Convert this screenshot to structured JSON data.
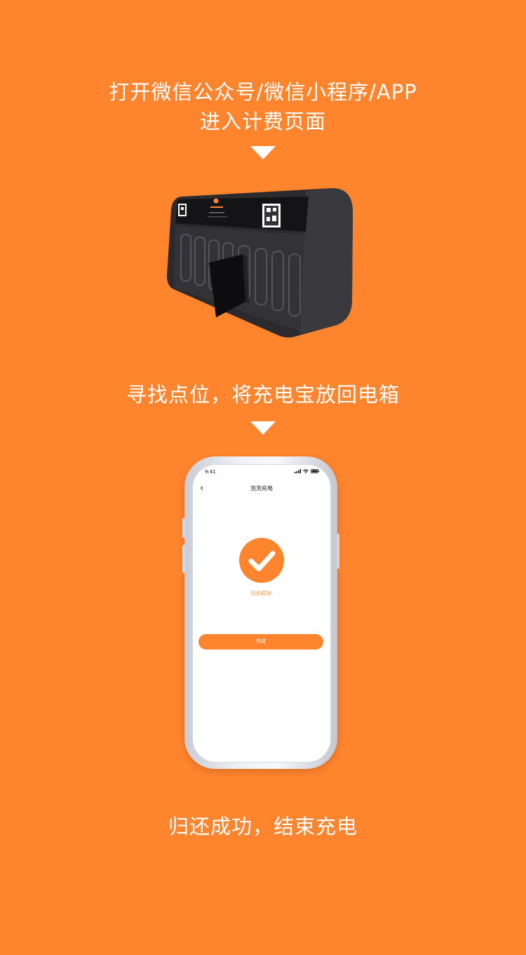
{
  "steps": [
    {
      "lines": [
        "打开微信公众号/微信小程序/APP",
        "进入计费页面"
      ]
    },
    {
      "lines": [
        "寻找点位，将充电宝放回电箱"
      ]
    },
    {
      "lines": [
        "归还成功，结束充电"
      ]
    }
  ],
  "phone": {
    "status_time": "9:41",
    "nav_title": "泡泡充电",
    "success_message": "归还成功!",
    "done_button_label": "完成"
  },
  "colors": {
    "background": "#ff842e",
    "accent": "#ff842e",
    "text_on_background": "#ffffff"
  },
  "icons": [
    "down-triangle-icon",
    "back-chevron-icon",
    "check-mark-icon",
    "signal-icon",
    "wifi-icon",
    "battery-icon"
  ]
}
